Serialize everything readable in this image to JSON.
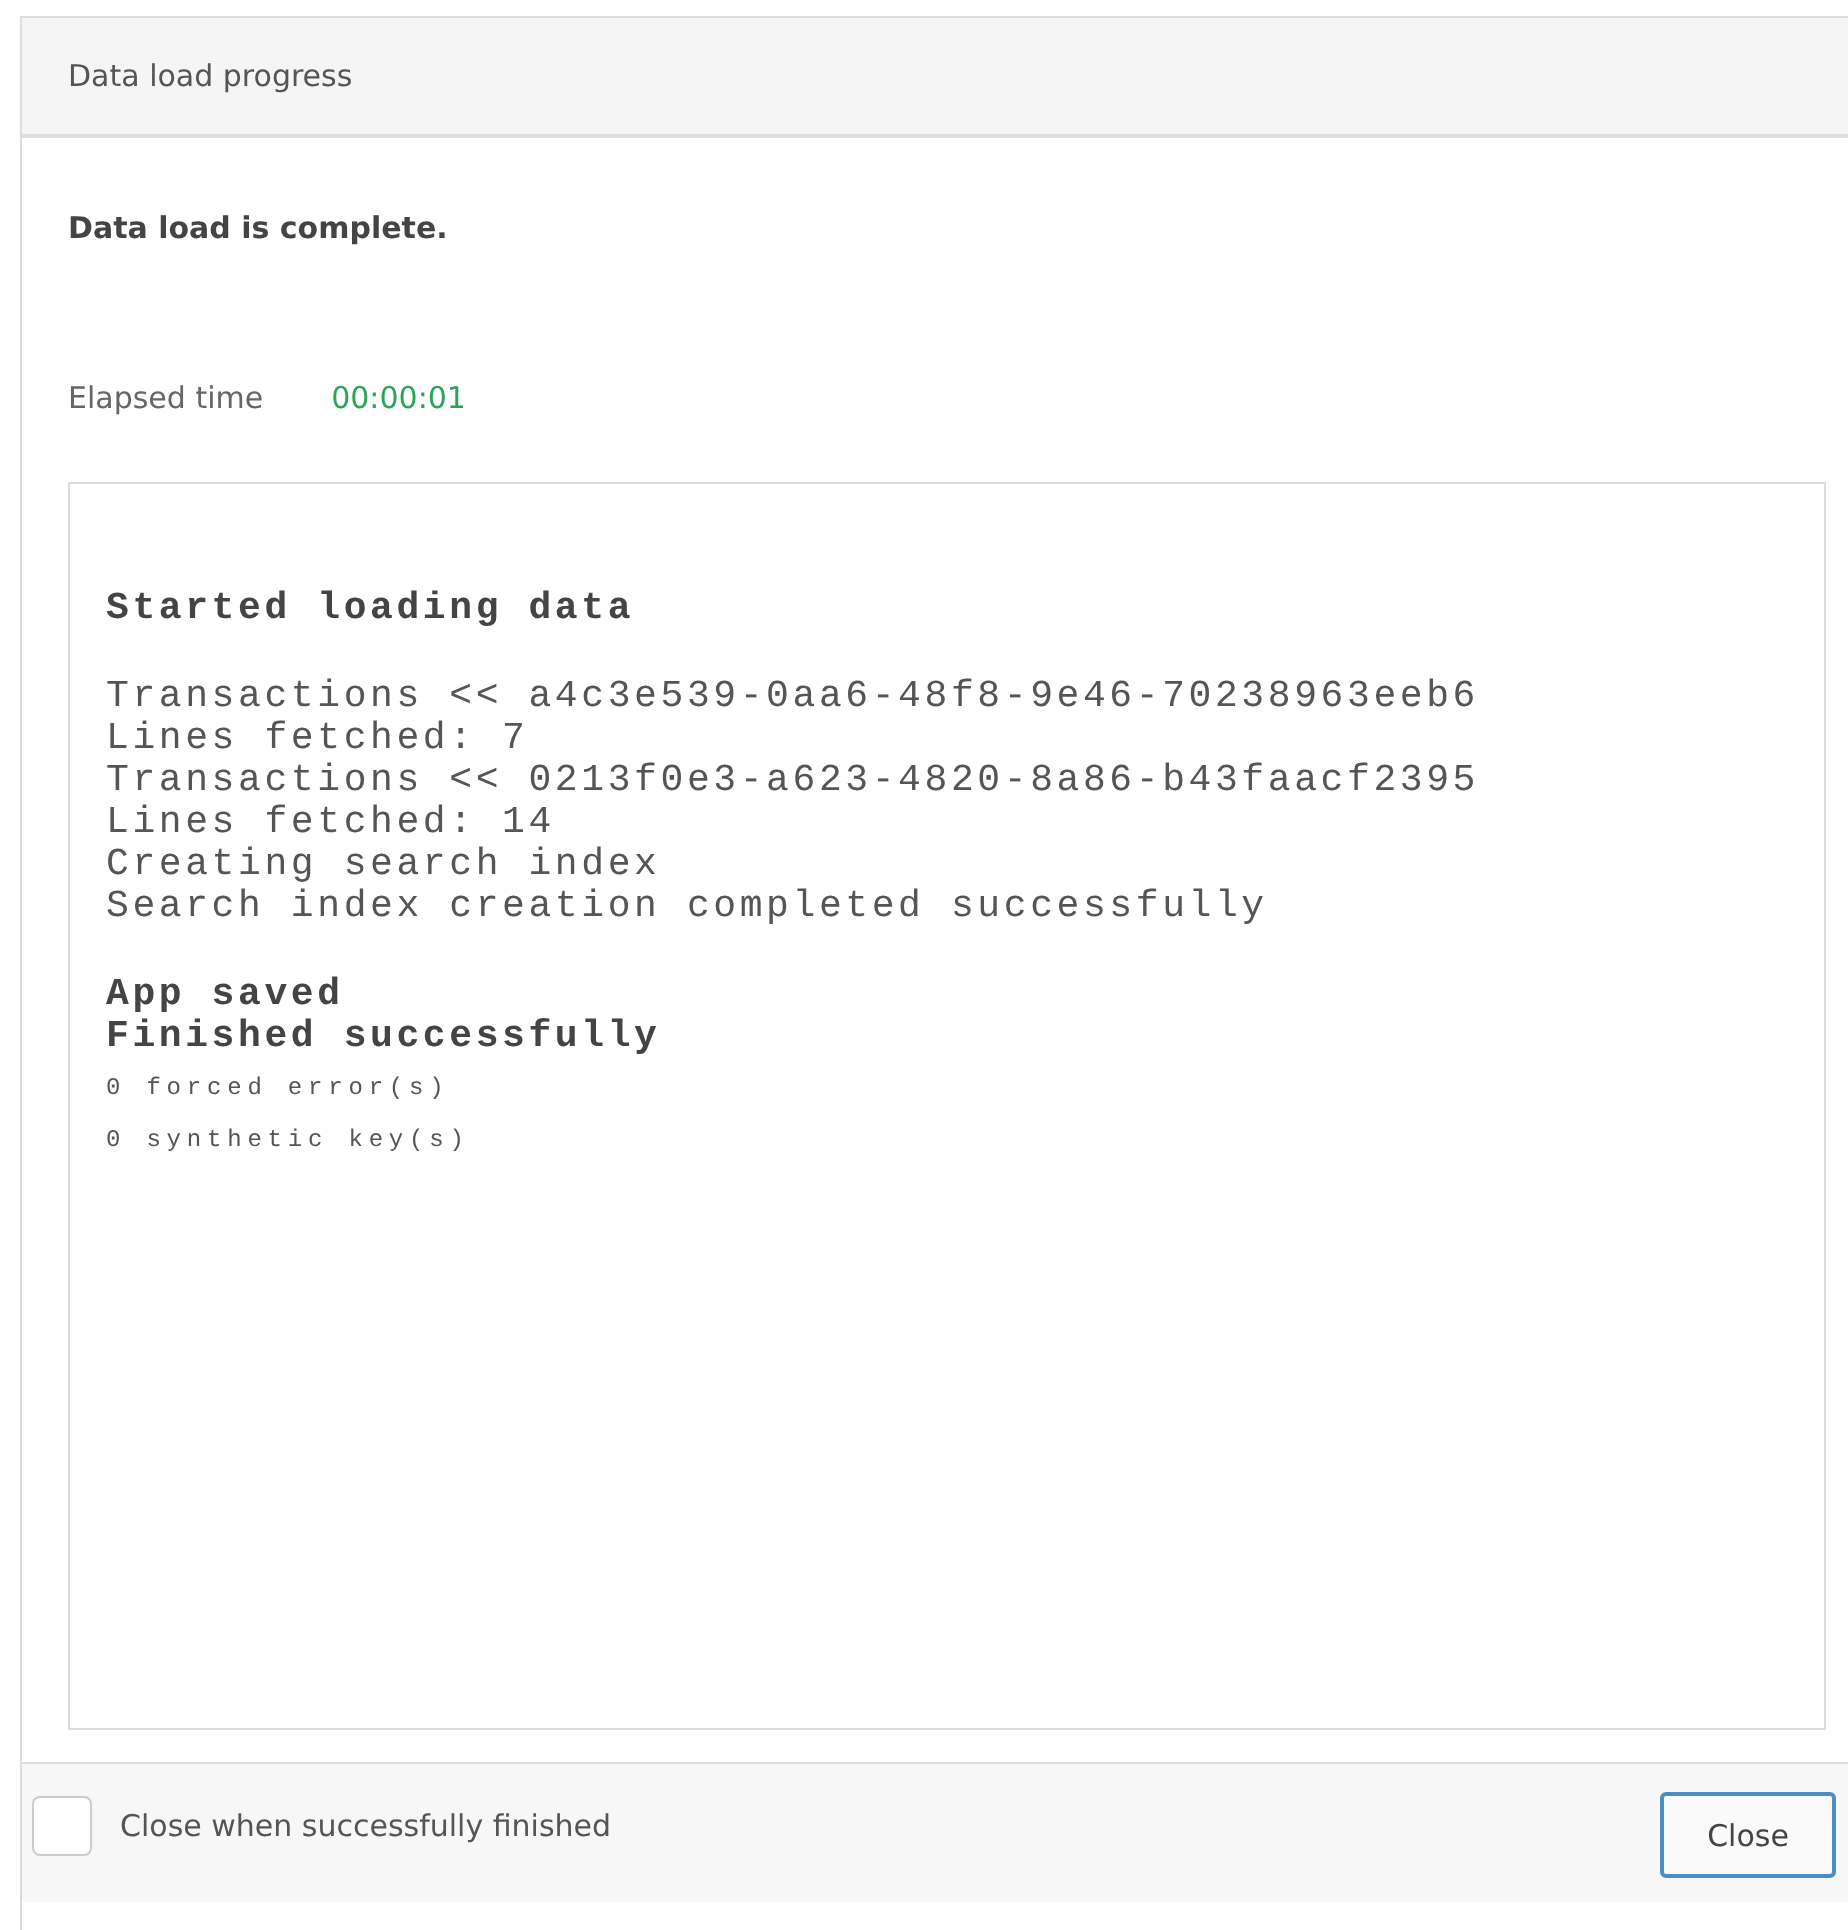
{
  "dialog": {
    "title": "Data load progress"
  },
  "status": "Data load is complete.",
  "elapsed": {
    "label": "Elapsed time",
    "value": "00:00:01"
  },
  "log": [
    {
      "kind": "heading",
      "lines": [
        "Started loading data"
      ]
    },
    {
      "kind": "plain",
      "lines": [
        "Transactions << a4c3e539-0aa6-48f8-9e46-70238963eeb6",
        "Lines fetched: 7",
        "Transactions << 0213f0e3-a623-4820-8a86-b43faacf2395",
        "Lines fetched: 14",
        "Creating search index",
        "Search index creation completed successfully"
      ]
    },
    {
      "kind": "heading",
      "lines": [
        "App saved",
        "Finished successfully"
      ]
    },
    {
      "kind": "small",
      "lines": [
        "0 forced error(s)",
        "0 synthetic key(s)"
      ]
    }
  ],
  "footer": {
    "checkbox": {
      "label": "Close when successfully finished",
      "checked": false
    },
    "button": "Close"
  }
}
